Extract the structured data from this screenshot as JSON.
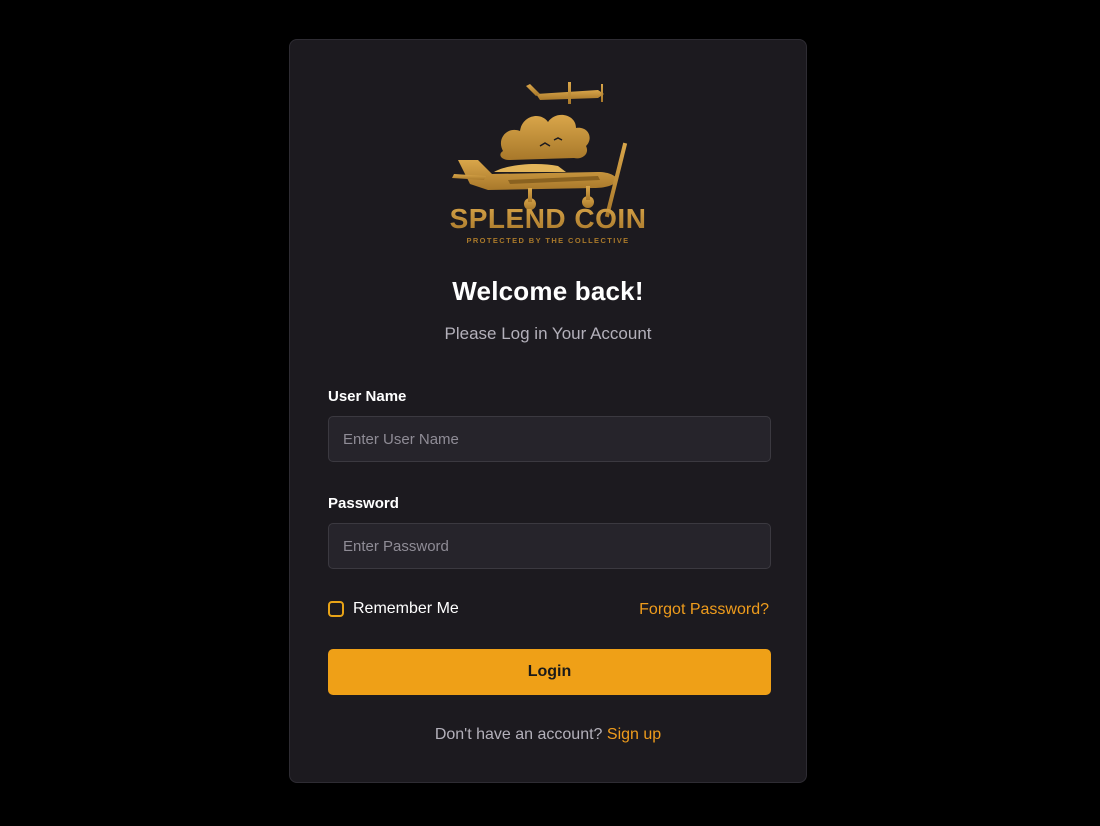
{
  "logo": {
    "brand_name": "SPLEND COIN",
    "tagline": "PROTECTED BY THE COLLECTIVE"
  },
  "heading": {
    "title": "Welcome back!",
    "subtitle": "Please Log in Your Account"
  },
  "form": {
    "username_label": "User Name",
    "username_placeholder": "Enter User Name",
    "username_value": "",
    "password_label": "Password",
    "password_placeholder": "Enter Password",
    "password_value": "",
    "remember_label": "Remember Me",
    "remember_checked": false,
    "forgot_label": "Forgot Password?",
    "login_label": "Login"
  },
  "footer": {
    "prompt": "Don't have an account?",
    "signup_label": "Sign up"
  },
  "colors": {
    "background": "#000000",
    "card": "#1c1a1f",
    "accent": "#efa017",
    "logo_gold": "#c08c30"
  }
}
